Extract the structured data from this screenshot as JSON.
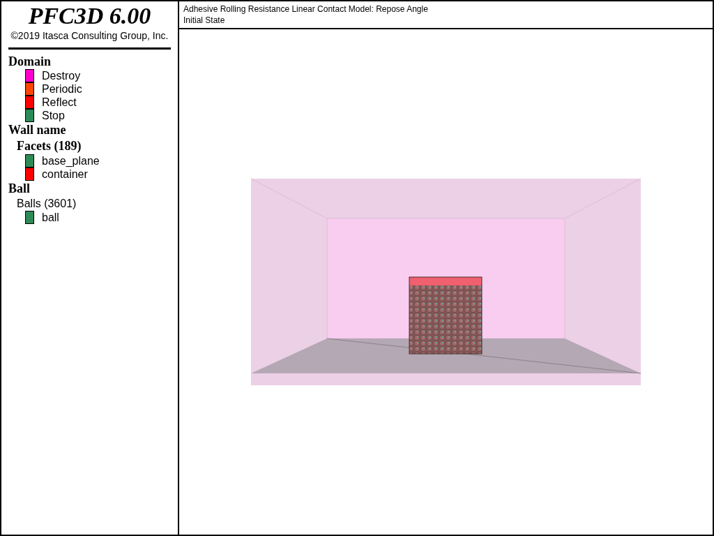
{
  "title": "PFC3D 6.00",
  "copyright": "©2019 Itasca Consulting Group, Inc.",
  "legend": [
    {
      "kind": "heading",
      "text": "Domain"
    },
    {
      "kind": "swatch",
      "text": "Destroy",
      "color": "#ff00cc"
    },
    {
      "kind": "swatch",
      "text": "Periodic",
      "color": "#ff4500"
    },
    {
      "kind": "swatch",
      "text": "Reflect",
      "color": "#ff0000"
    },
    {
      "kind": "swatch",
      "text": "Stop",
      "color": "#2e8b57"
    },
    {
      "kind": "heading",
      "text": "Wall name"
    },
    {
      "kind": "subheading",
      "text": "Facets (189)"
    },
    {
      "kind": "swatch",
      "text": "base_plane",
      "color": "#2e8b57"
    },
    {
      "kind": "swatch",
      "text": "container",
      "color": "#ff0000"
    },
    {
      "kind": "heading",
      "text": "Ball"
    },
    {
      "kind": "group",
      "text": "Balls (3601)"
    },
    {
      "kind": "swatch",
      "text": "ball",
      "color": "#2e8b57"
    }
  ],
  "plot": {
    "title_lines": [
      "Adhesive Rolling Resistance Linear Contact Model: Repose Angle",
      "Initial State"
    ]
  }
}
